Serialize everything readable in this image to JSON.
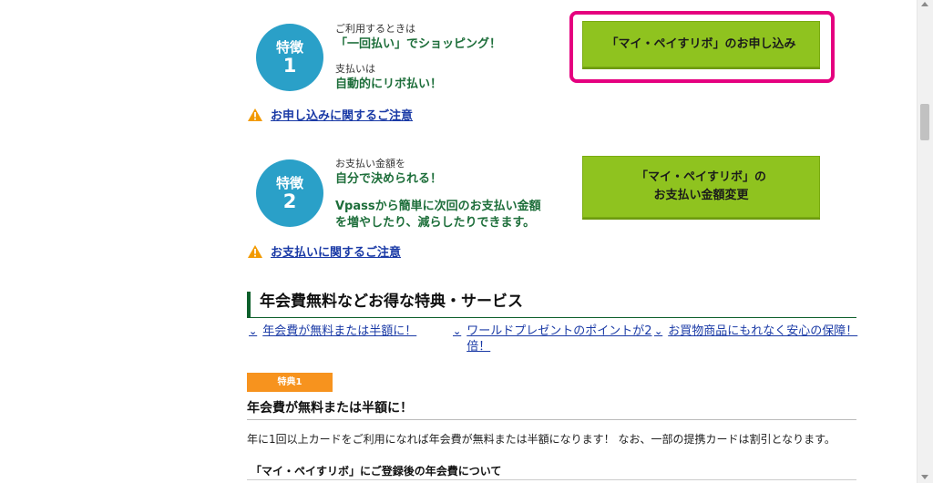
{
  "feature1": {
    "label": "特徴",
    "num": "1",
    "small1": "ご利用するときは",
    "big1": "「一回払い」でショッピング！",
    "small2": "支払いは",
    "big2": "自動的にリボ払い！",
    "caution": "お申し込みに関するご注意",
    "cta": "「マイ・ペイすリボ」のお申し込み"
  },
  "feature2": {
    "label": "特徴",
    "num": "2",
    "small1": "お支払い金額を",
    "big1": "自分で決められる！",
    "big2a": "Vpassから簡単に次回のお支払い金額",
    "big2b": "を増やしたり、減らしたりできます。",
    "caution": "お支払いに関するご注意",
    "cta_line1": "「マイ・ペイすリボ」の",
    "cta_line2": "お支払い金額変更"
  },
  "section": {
    "title": "年会費無料などお得な特典・サービス",
    "anchors": [
      {
        "line1": "年会費が無料または半額に！",
        "line2": ""
      },
      {
        "line1": "ワールドプレゼントのポイントが2",
        "line2": "倍！"
      },
      {
        "line1": "お買物商品にもれなく安心の保障！",
        "line2": ""
      }
    ]
  },
  "benefit1": {
    "badge": "特典1",
    "title": "年会費が無料または半額に！",
    "text": "年に1回以上カードをご利用になれば年会費が無料または半額になります！ なお、一部の提携カードは割引となります。",
    "subtitle": "「マイ・ペイすリボ」にご登録後の年会費について"
  },
  "colors": {
    "circle": "#2aa0c8",
    "cta": "#8fc31f",
    "highlight": "#e5007f",
    "heading_green": "#0d5f2b",
    "link": "#1a3aa6"
  }
}
